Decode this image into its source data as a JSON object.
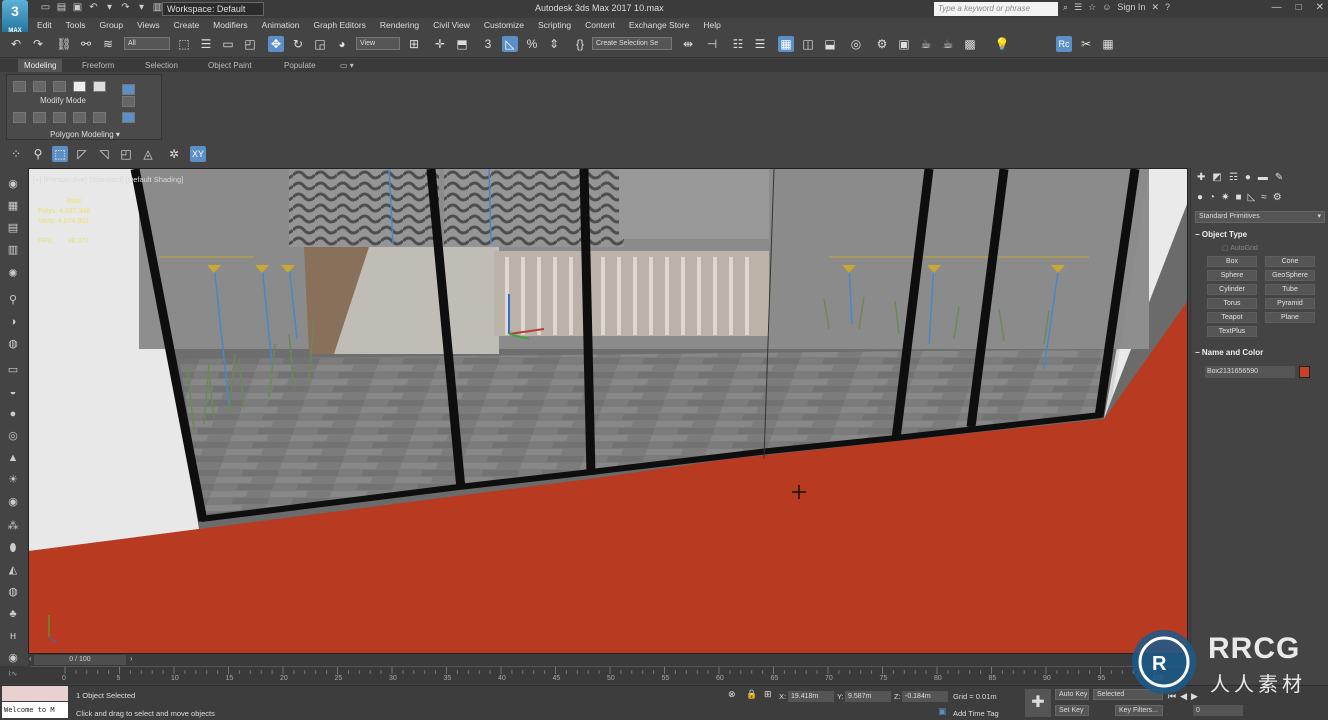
{
  "titlebar": {
    "logo_text": "3",
    "logo_sub": "MAX",
    "workspace": "Workspace: Default",
    "title": "Autodesk 3ds Max 2017    10.max",
    "search_placeholder": "Type a keyword or phrase",
    "sign_in": "Sign In"
  },
  "menu": [
    "Edit",
    "Tools",
    "Group",
    "Views",
    "Create",
    "Modifiers",
    "Animation",
    "Graph Editors",
    "Rendering",
    "Civil View",
    "Customize",
    "Scripting",
    "Content",
    "Exchange Store",
    "Help"
  ],
  "toolbar": {
    "selection_filter": "All",
    "ref_coord": "View",
    "named_selection": "Create Selection Se"
  },
  "ribbon": {
    "tabs": [
      "Modeling",
      "Freeform",
      "Selection",
      "Object Paint",
      "Populate"
    ],
    "modify_mode": "Modify Mode",
    "polygon_modeling": "Polygon Modeling"
  },
  "viewport": {
    "label": "[+] [Perspective] [Standard] [Default Shading]",
    "stats_total": "Total",
    "polys_label": "Polys:",
    "polys_value": "4,037,348",
    "verts_label": "Verts:",
    "verts_value": "4,074,901",
    "fps_label": "FPS:",
    "fps_value": "38.377"
  },
  "command_panel": {
    "category": "Standard Primitives",
    "object_type_title": "Object Type",
    "autogrid": "AutoGrid",
    "objects": [
      "Box",
      "Cone",
      "Sphere",
      "GeoSphere",
      "Cylinder",
      "Tube",
      "Torus",
      "Pyramid",
      "Teapot",
      "Plane",
      "TextPlus"
    ],
    "name_color_title": "Name and Color",
    "object_name": "Box2131656590",
    "object_color": "#c94026"
  },
  "timeline": {
    "slider": "0 / 100",
    "ticks": [
      "0",
      "5",
      "10",
      "15",
      "20",
      "25",
      "30",
      "35",
      "40",
      "45",
      "50",
      "55",
      "60",
      "65",
      "70",
      "75",
      "80",
      "85",
      "90",
      "95",
      "100"
    ]
  },
  "status": {
    "welcome": "Welcome to M",
    "selected": "1 Object Selected",
    "prompt": "Click and drag to select and move objects",
    "x_label": "X:",
    "x_value": "19.418m",
    "y_label": "Y:",
    "y_value": "9.587m",
    "z_label": "Z:",
    "z_value": "-0.184m",
    "grid": "Grid = 0.01m",
    "add_time_tag": "Add Time Tag",
    "auto_key": "Auto Key",
    "selected_dd": "Selected",
    "set_key": "Set Key",
    "key_filters": "Key Filters...",
    "frame": "0"
  },
  "watermark": {
    "brand": "RRCG",
    "sub": "人人素材"
  },
  "colors": {
    "floor_red": "#b83a20",
    "ui_bg": "#444444",
    "active_blue": "#5b8fc6"
  }
}
